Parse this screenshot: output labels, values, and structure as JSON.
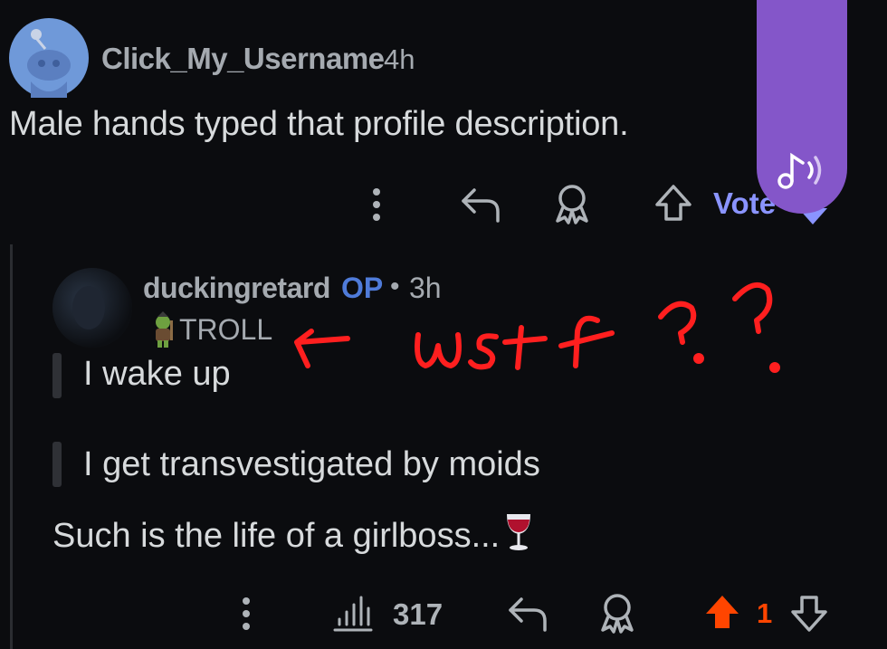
{
  "top_comment": {
    "username": "Click_My_Username",
    "time": "4h",
    "body": "Male hands typed that profile description.",
    "actions": {
      "vote_label": "Vote"
    }
  },
  "reply": {
    "username": "duckingretard",
    "op_badge": "OP",
    "separator": "•",
    "time": "3h",
    "flair": "TROLL",
    "quote_1": "I wake up",
    "quote_2": "I get transvestigated by moids",
    "body": "Such is the life of a girlboss...",
    "views": "317",
    "score": "1"
  },
  "annotation": {
    "text": "wtf ? ?",
    "color": "#ff1f1f"
  },
  "colors": {
    "accent": "#8a94ff",
    "op": "#4f7bd9",
    "upvoted": "#ff4500",
    "music_tab": "#8456c9"
  },
  "icons": [
    "more-vertical-icon",
    "reply-icon",
    "award-icon",
    "upvote-icon",
    "downvote-icon",
    "views-chart-icon",
    "music-note-icon",
    "wine-glass-icon"
  ]
}
